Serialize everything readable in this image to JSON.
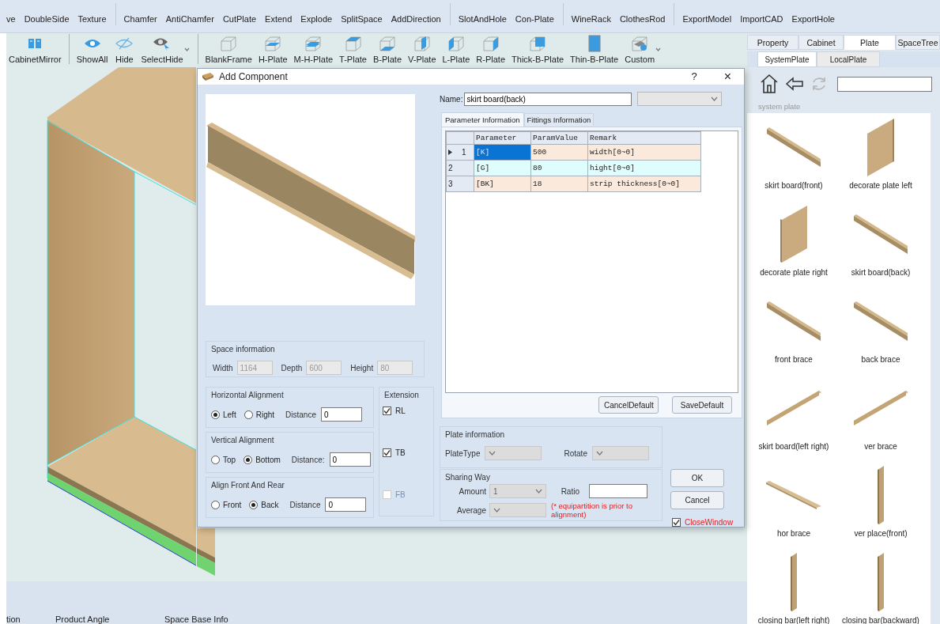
{
  "toolbar": {
    "row_1": [
      [
        "ve",
        "DoubleSide",
        "Texture"
      ],
      [
        "Chamfer",
        "AntiChamfer",
        "CutPlate",
        "Extend",
        "Explode",
        "SplitSpace",
        "AddDirection"
      ],
      [
        "SlotAndHole",
        "Con-Plate"
      ],
      [
        "WineRack",
        "ClothesRod"
      ],
      [
        "ExportModel",
        "ImportCAD",
        "ExportHole"
      ]
    ],
    "row_2": [
      [
        "CabinetMirror"
      ],
      [
        "ShowAll",
        "Hide",
        "SelectHide"
      ],
      [
        "BlankFrame",
        "H-Plate",
        "M-H-Plate",
        "T-Plate",
        "B-Plate",
        "V-Plate",
        "L-Plate",
        "R-Plate",
        "Thick-B-Plate",
        "Thin-B-Plate",
        "Custom"
      ]
    ]
  },
  "dialog": {
    "title": "Add Component",
    "help": "?",
    "close": "×",
    "space_information": {
      "title": "Space information",
      "fields": [
        {
          "label": "Width",
          "value": "1164",
          "disabled": true
        },
        {
          "label": "Depth",
          "value": "600",
          "disabled": true
        },
        {
          "label": "Height",
          "value": "80",
          "disabled": true
        }
      ]
    },
    "alignments": [
      {
        "title": "Horizontal Alignment",
        "options": [
          {
            "label": "Left",
            "selected": true
          },
          {
            "label": "Right",
            "selected": false
          }
        ],
        "distance_label": "Distance",
        "distance": "0"
      },
      {
        "title": "Vertical Alignment",
        "options": [
          {
            "label": "Top",
            "selected": false
          },
          {
            "label": "Bottom",
            "selected": true
          }
        ],
        "distance_label": "Distance:",
        "distance": "0"
      },
      {
        "title": "Align Front And Rear",
        "options": [
          {
            "label": "Front",
            "selected": false
          },
          {
            "label": "Back",
            "selected": true
          }
        ],
        "distance_label": "Distance",
        "distance": "0"
      }
    ],
    "extension": {
      "title": "Extension",
      "items": [
        {
          "label": "RL",
          "checked": true,
          "disabled": false
        },
        {
          "label": "TB",
          "checked": true,
          "disabled": false
        },
        {
          "label": "FB",
          "checked": false,
          "disabled": true
        }
      ]
    },
    "name": {
      "label": "Name:",
      "value": "skirt board(back)"
    },
    "tabs": [
      {
        "label": "Parameter Information",
        "selected": true
      },
      {
        "label": "Fittings Information",
        "selected": false
      }
    ],
    "parameter_table": {
      "columns": [
        "Parameter",
        "ParamValue",
        "Remark"
      ],
      "rows": [
        {
          "number": "1",
          "selected": true,
          "color": "#fbe9dc",
          "cells": [
            "[K]",
            "500",
            "width[0~0]"
          ]
        },
        {
          "number": "2",
          "selected": false,
          "color": "#e0fdfd",
          "cells": [
            "[G]",
            "80",
            "hight[0~0]"
          ]
        },
        {
          "number": "3",
          "selected": false,
          "color": "#fbe9dc",
          "cells": [
            "[BK]",
            "18",
            "strip thickness[0~0]"
          ]
        }
      ]
    },
    "table_buttons": [
      "CancelDefault",
      "SaveDefault"
    ],
    "plate_information": {
      "title": "Plate information",
      "fields": [
        "PlateType",
        "Rotate"
      ]
    },
    "sharing_way": {
      "title": "Sharing Way",
      "amount_label": "Amount",
      "amount": "1",
      "average_label": "Average",
      "ratio_label": "Ratio",
      "note": "(* equipartition is prior to alignment)"
    },
    "buttons": [
      "OK",
      "Cancel"
    ],
    "close_window": {
      "label": "CloseWindow",
      "checked": true
    }
  },
  "side_panel": {
    "tabs": [
      {
        "label": "Property",
        "selected": false
      },
      {
        "label": "Cabinet",
        "selected": false
      },
      {
        "label": "Plate",
        "selected": true
      },
      {
        "label": "SpaceTree",
        "selected": false
      }
    ],
    "subtabs": [
      {
        "label": "SystemPlate",
        "selected": true
      },
      {
        "label": "LocalPlate",
        "selected": false
      }
    ],
    "path": "system plate",
    "items": [
      {
        "label": "skirt board(front)"
      },
      {
        "label": "decorate plate left"
      },
      {
        "label": "decorate plate right"
      },
      {
        "label": "skirt board(back)"
      },
      {
        "label": "front brace"
      },
      {
        "label": "back brace"
      },
      {
        "label": "skirt board(left right)"
      },
      {
        "label": "ver brace"
      },
      {
        "label": "hor brace"
      },
      {
        "label": "ver place(front)"
      },
      {
        "label": "closing bar(left right)"
      },
      {
        "label": "closing bar(backward)"
      }
    ]
  },
  "status_bar": [
    "tion",
    "Product Angle",
    "Space Base Info"
  ]
}
